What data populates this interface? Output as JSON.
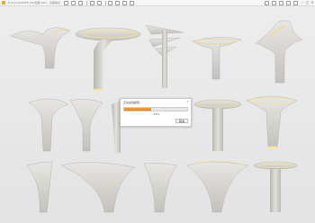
{
  "window": {
    "title": "D:/Lamps/SAFE_R3/出图.3dm - 渲染输出"
  },
  "toolbar": {
    "left_icons": [
      "new-file-icon",
      "open-icon",
      "save-icon",
      "undo-icon",
      "redo-icon",
      "render-icon",
      "camera-icon",
      "image-icon",
      "settings-icon"
    ],
    "right_icons": [
      "grid-icon",
      "layers-icon",
      "light-icon",
      "window-icon",
      "help-icon"
    ]
  },
  "dialog": {
    "title": "正在加载模型...",
    "progress_percent": 43,
    "progress_text": "43%",
    "cancel_label": "取消"
  },
  "colors": {
    "accent": "#ef7d10",
    "background": "#e6e6e6",
    "model": "#d8d6d2",
    "glow": "#f7e6a3"
  }
}
